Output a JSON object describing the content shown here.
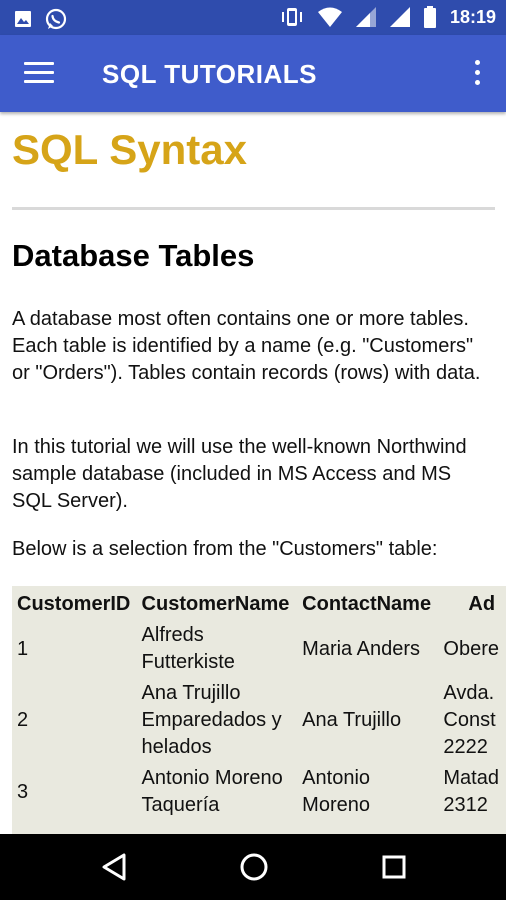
{
  "status_bar": {
    "time": "18:19",
    "icons": [
      "image-icon",
      "whatsapp-icon",
      "vibrate-icon",
      "wifi-icon",
      "signal-icon",
      "signal-icon",
      "battery-icon"
    ]
  },
  "app_bar": {
    "title": "SQL TUTORIALS",
    "menu_icon": "hamburger-menu-icon",
    "overflow_icon": "more-vert-icon"
  },
  "content": {
    "page_title": "SQL Syntax",
    "section_heading": "Database Tables",
    "paragraphs": [
      "A database most often contains one or more tables. Each table is identified by a name (e.g. \"Customers\" or \"Orders\"). Tables contain records (rows) with data.",
      "In this tutorial we will use the well-known Northwind sample database (included in MS Access and MS SQL Server).",
      "Below is a selection from the \"Customers\" table:"
    ],
    "table": {
      "headers": [
        "CustomerID",
        "CustomerName",
        "ContactName",
        "Ad"
      ],
      "rows": [
        [
          "1",
          "Alfreds Futterkiste",
          "Maria Anders",
          "Obere"
        ],
        [
          "2",
          "Ana Trujillo Emparedados y helados",
          "Ana Trujillo",
          "Avda. Const 2222"
        ],
        [
          "3",
          "Antonio Moreno Taquería",
          "Antonio Moreno",
          "Matad 2312"
        ]
      ]
    }
  },
  "nav_bar": {
    "back_icon": "back-triangle-icon",
    "home_icon": "home-circle-icon",
    "recent_icon": "recent-apps-square-icon"
  },
  "colors": {
    "status_bar": "#2f4cad",
    "app_bar": "#3f5ccb",
    "title_accent": "#d6a418",
    "table_bg": "#e9e9df"
  }
}
